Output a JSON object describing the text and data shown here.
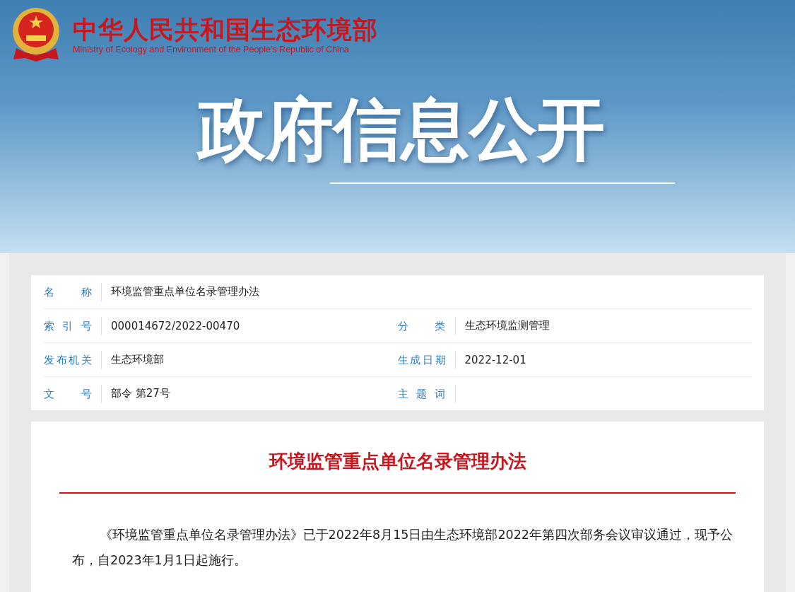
{
  "header": {
    "title": "中华人民共和国生态环境部",
    "subtitle": "Ministry of Ecology and Environment of the People's Republic of China",
    "banner": "政府信息公开"
  },
  "meta": [
    [
      {
        "label": "名 称",
        "value": "环境监管重点单位名录管理办法"
      }
    ],
    [
      {
        "label": "索 引 号",
        "value": "000014672/2022-00470"
      },
      {
        "label": "分 类",
        "value": "生态环境监测管理"
      }
    ],
    [
      {
        "label": "发布机关",
        "value": "生态环境部"
      },
      {
        "label": "生成日期",
        "value": "2022-12-01"
      }
    ],
    [
      {
        "label": "文 号",
        "value": "部令 第27号"
      },
      {
        "label": "主 题 词"
      }
    ]
  ],
  "article": {
    "title": "环境监管重点单位名录管理办法",
    "body": "《环境监管重点单位名录管理办法》已于2022年8月15日由生态环境部2022年第四次部务会议审议通过，现予公布，自2023年1月1日起施行。"
  }
}
